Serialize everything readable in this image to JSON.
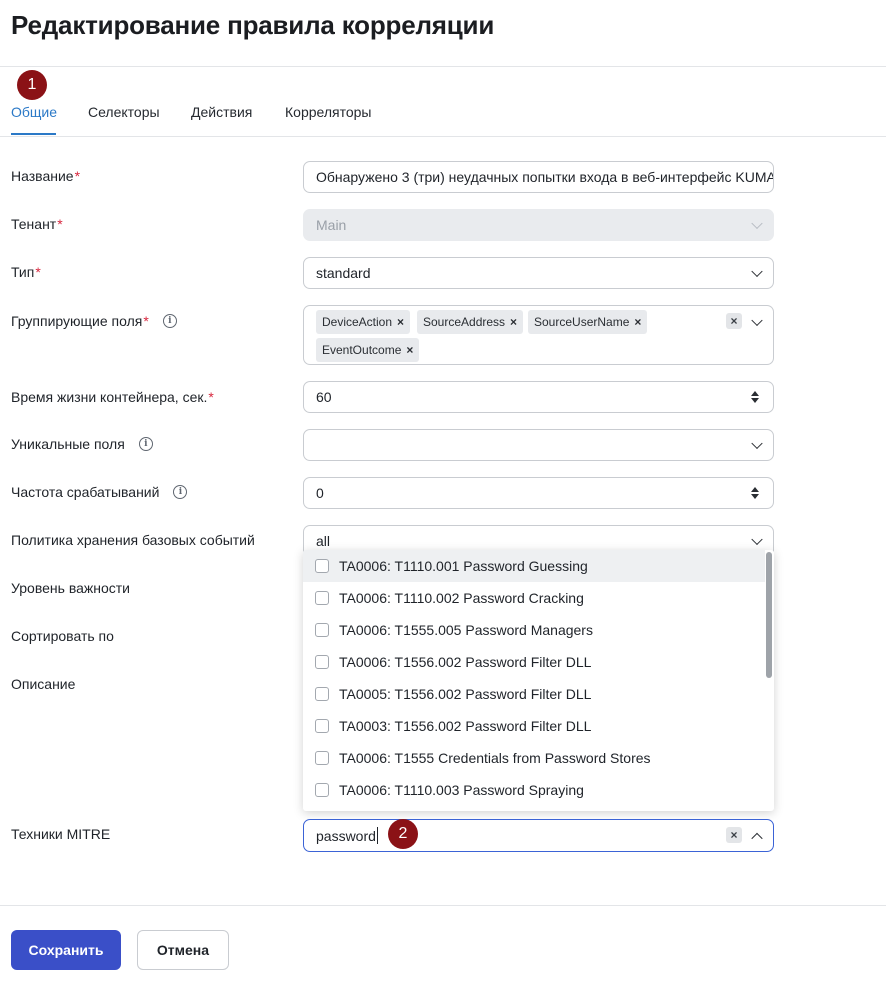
{
  "page": {
    "title": "Редактирование правила корреляции"
  },
  "markers": {
    "m1": "1",
    "m2": "2"
  },
  "tabs": [
    {
      "label": "Общие",
      "active": true
    },
    {
      "label": "Селекторы"
    },
    {
      "label": "Действия"
    },
    {
      "label": "Корреляторы"
    }
  ],
  "form": {
    "name": {
      "label": "Название",
      "value": "Обнаружено 3 (три) неудачных попытки входа в веб-интерфейс KUMA"
    },
    "tenant": {
      "label": "Тенант",
      "value": "Main"
    },
    "type": {
      "label": "Тип",
      "value": "standard"
    },
    "group_fields": {
      "label": "Группирующие поля",
      "tags": [
        "DeviceAction",
        "SourceAddress",
        "SourceUserName",
        "EventOutcome"
      ]
    },
    "ttl": {
      "label": "Время жизни контейнера, сек.",
      "value": "60"
    },
    "unique_fields": {
      "label": "Уникальные поля",
      "value": ""
    },
    "frequency": {
      "label": "Частота срабатываний",
      "value": "0"
    },
    "retention": {
      "label": "Политика хранения базовых событий",
      "value": "all"
    },
    "severity": {
      "label": "Уровень важности"
    },
    "sort_by": {
      "label": "Сортировать по"
    },
    "description": {
      "label": "Описание"
    },
    "mitre": {
      "label": "Техники MITRE",
      "value": "password"
    }
  },
  "dropdown_options": [
    "TA0006: T1110.001 Password Guessing",
    "TA0006: T1110.002 Password Cracking",
    "TA0006: T1555.005 Password Managers",
    "TA0006: T1556.002 Password Filter DLL",
    "TA0005: T1556.002 Password Filter DLL",
    "TA0003: T1556.002 Password Filter DLL",
    "TA0006: T1555 Credentials from Password Stores",
    "TA0006: T1110.003 Password Spraying"
  ],
  "buttons": {
    "save": "Сохранить",
    "cancel": "Отмена"
  },
  "required_mark": "*",
  "icons": {
    "info": "info-icon",
    "clear": "clear-icon",
    "chevron": "chevron-down-icon",
    "spinner": "number-spinner-icon"
  },
  "colors": {
    "accent": "#2b79c7",
    "primary_button": "#3a4fc8",
    "marker": "#8b1216",
    "required": "#d7263d",
    "focus_border": "#3b63d6"
  }
}
